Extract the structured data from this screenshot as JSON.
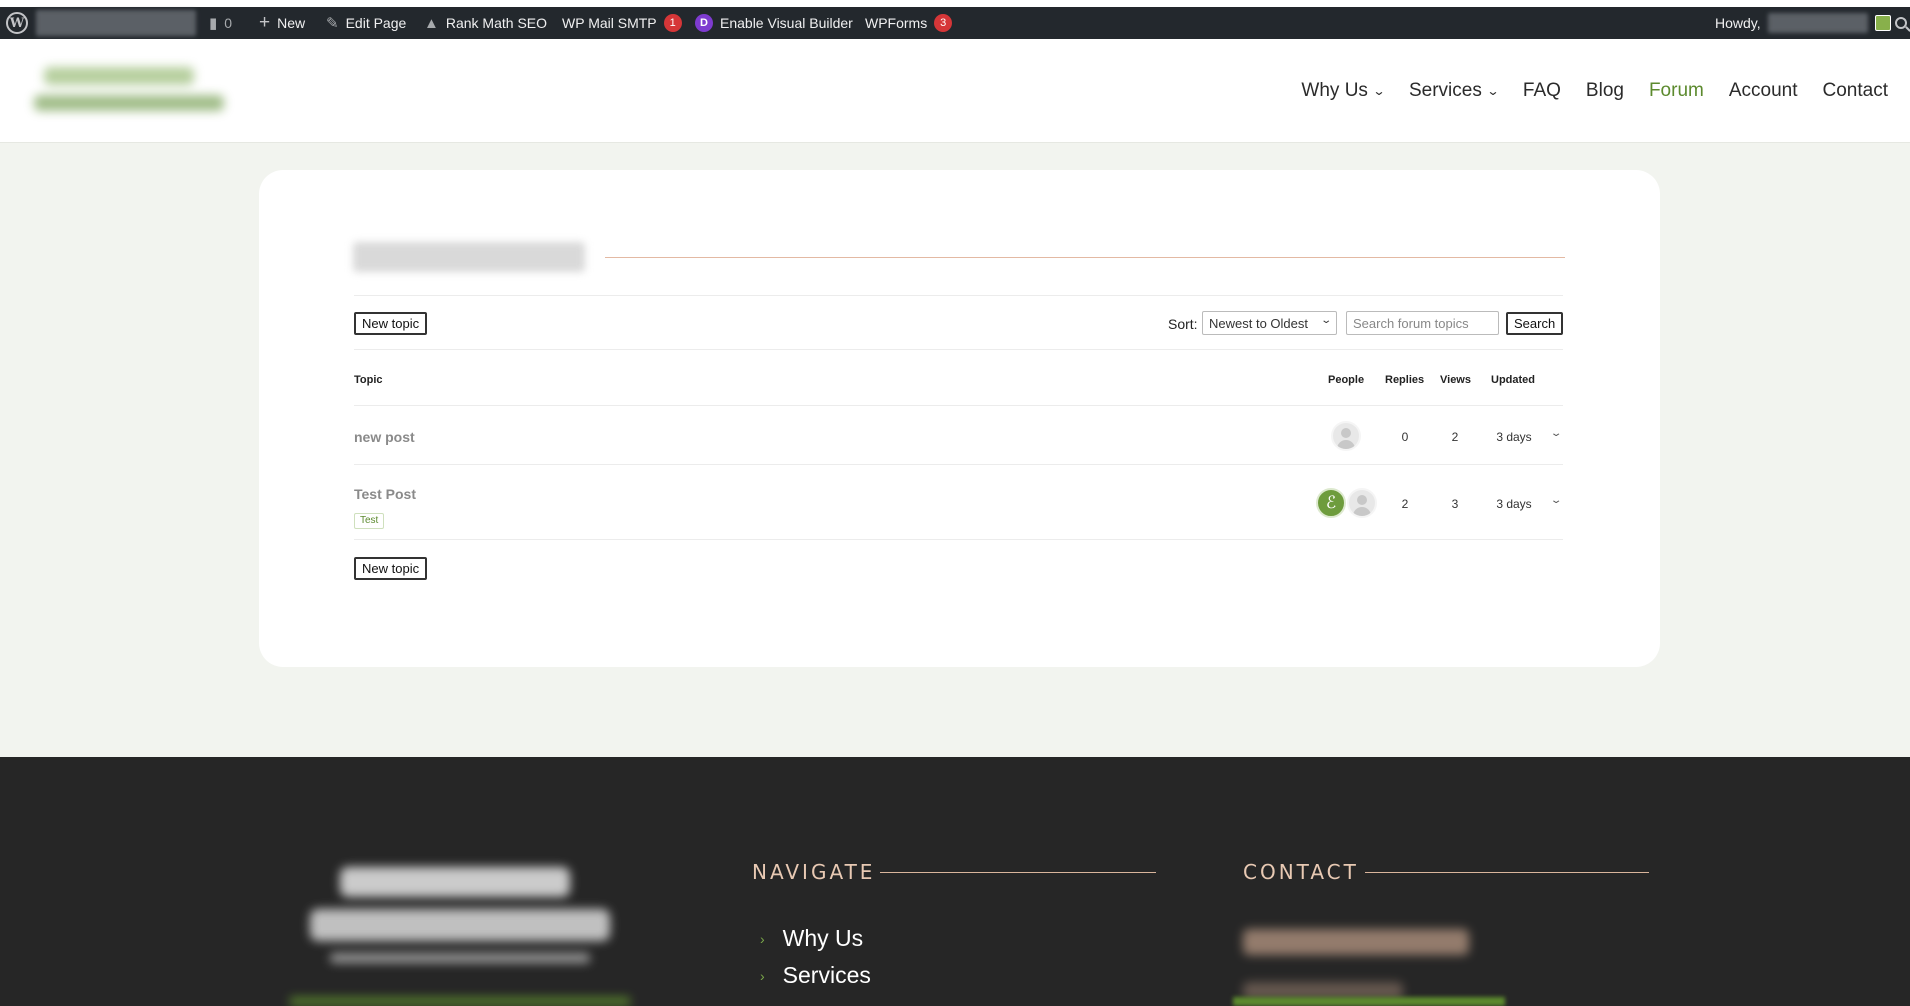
{
  "admin_bar": {
    "comments_count": "0",
    "new_label": "New",
    "edit_page_label": "Edit Page",
    "rank_math_label": "Rank Math SEO",
    "wp_mail_smtp_label": "WP Mail SMTP",
    "wp_mail_smtp_badge": "1",
    "divi_letter": "D",
    "visual_builder_label": "Enable Visual Builder",
    "wpforms_label": "WPForms",
    "wpforms_badge": "3",
    "howdy_label": "Howdy,"
  },
  "nav": {
    "items": [
      {
        "label": "Why Us",
        "has_dropdown": true
      },
      {
        "label": "Services",
        "has_dropdown": true
      },
      {
        "label": "FAQ"
      },
      {
        "label": "Blog"
      },
      {
        "label": "Forum",
        "active": true
      },
      {
        "label": "Account"
      },
      {
        "label": "Contact"
      }
    ]
  },
  "forum": {
    "new_topic_label": "New topic",
    "sort_label": "Sort:",
    "sort_value": "Newest to Oldest",
    "search_placeholder": "Search forum topics",
    "search_button": "Search",
    "columns": {
      "topic": "Topic",
      "people": "People",
      "replies": "Replies",
      "views": "Views",
      "updated": "Updated"
    },
    "topics": [
      {
        "title": "new post",
        "replies": "0",
        "views": "2",
        "updated": "3 days"
      },
      {
        "title": "Test Post",
        "tag": "Test",
        "replies": "2",
        "views": "3",
        "updated": "3 days"
      }
    ]
  },
  "footer": {
    "navigate_heading": "NAVIGATE",
    "contact_heading": "CONTACT",
    "links": [
      "Why Us",
      "Services"
    ]
  },
  "colors": {
    "accent_green": "#5c8a2e",
    "admin_bar": "#23282d",
    "footer_bg": "#262626",
    "heading_peach": "#e8c9b3"
  }
}
